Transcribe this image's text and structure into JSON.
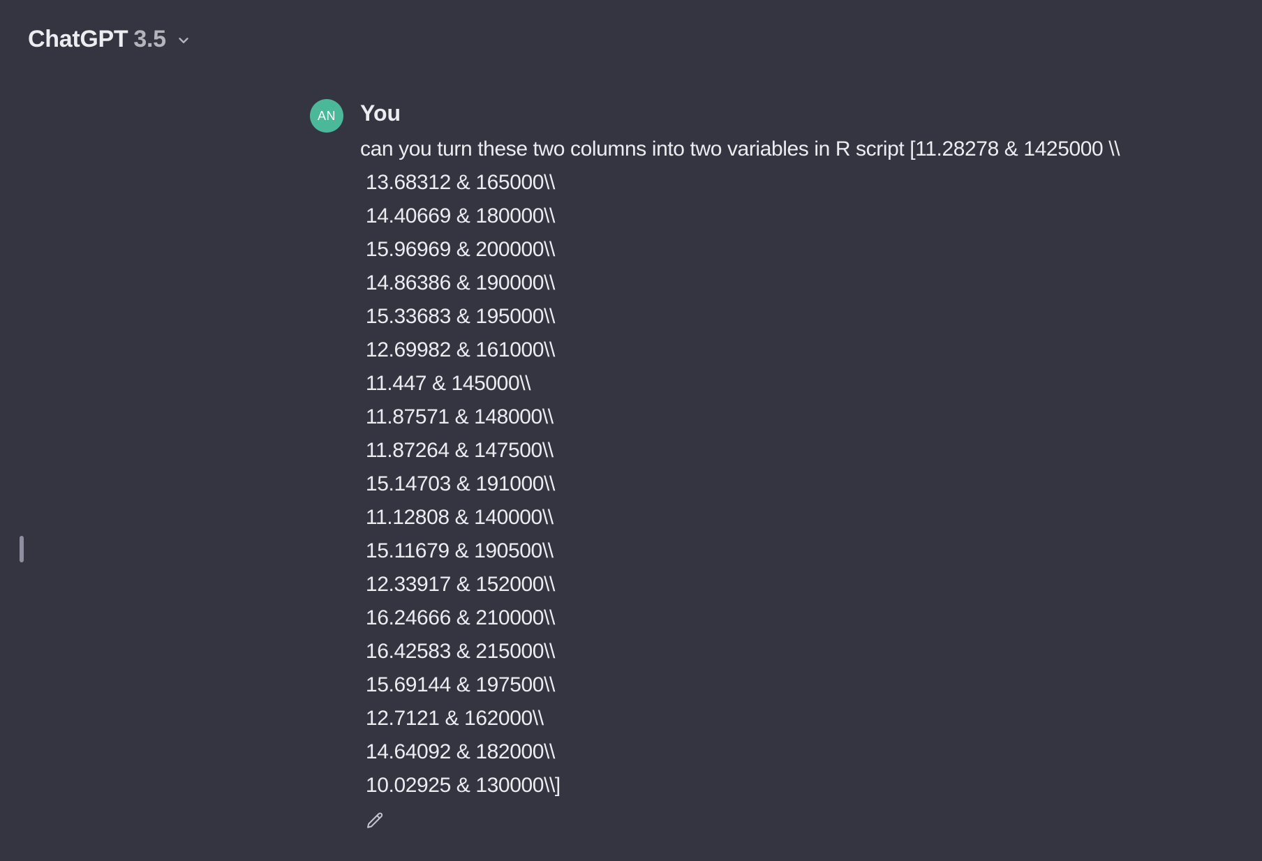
{
  "header": {
    "app_name": "ChatGPT",
    "model_version": "3.5",
    "dropdown_icon": "chevron-down-icon"
  },
  "message": {
    "avatar_initials": "AN",
    "avatar_color": "#4cb89a",
    "author": "You",
    "lines": [
      "can you turn these two columns into two variables in R script [11.28278 & 1425000 \\\\",
      " 13.68312 & 165000\\\\",
      " 14.40669 & 180000\\\\",
      " 15.96969 & 200000\\\\",
      " 14.86386 & 190000\\\\",
      " 15.33683 & 195000\\\\",
      " 12.69982 & 161000\\\\",
      " 11.447 & 145000\\\\",
      " 11.87571 & 148000\\\\",
      " 11.87264 & 147500\\\\",
      " 15.14703 & 191000\\\\",
      " 11.12808 & 140000\\\\",
      " 15.11679 & 190500\\\\",
      " 12.33917 & 152000\\\\",
      " 16.24666 & 210000\\\\",
      " 16.42583 & 215000\\\\",
      " 15.69144 & 197500\\\\",
      " 12.7121 & 162000\\\\",
      " 14.64092 & 182000\\\\",
      " 10.02925 & 130000\\\\]"
    ],
    "edit_icon": "pencil-icon"
  },
  "colors": {
    "background": "#343541",
    "text": "#ececf1",
    "muted": "#b4b4bd"
  }
}
